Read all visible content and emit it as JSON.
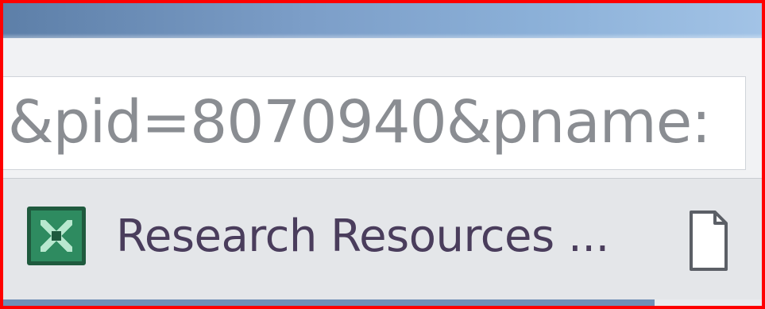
{
  "address_bar": {
    "url_fragment": ":&pid=8070940&pname:"
  },
  "bookmarks_bar": {
    "items": [
      {
        "label": "Research Resources ...",
        "icon": "research-resources-favicon"
      },
      {
        "label": "",
        "icon": "blank-page-icon"
      }
    ]
  },
  "colors": {
    "border": "#ff0000",
    "title_strip": "#7c9ec8",
    "url_text": "#8a8d92",
    "bookmark_text": "#4a3d5c",
    "favicon": "#2e8b60"
  }
}
